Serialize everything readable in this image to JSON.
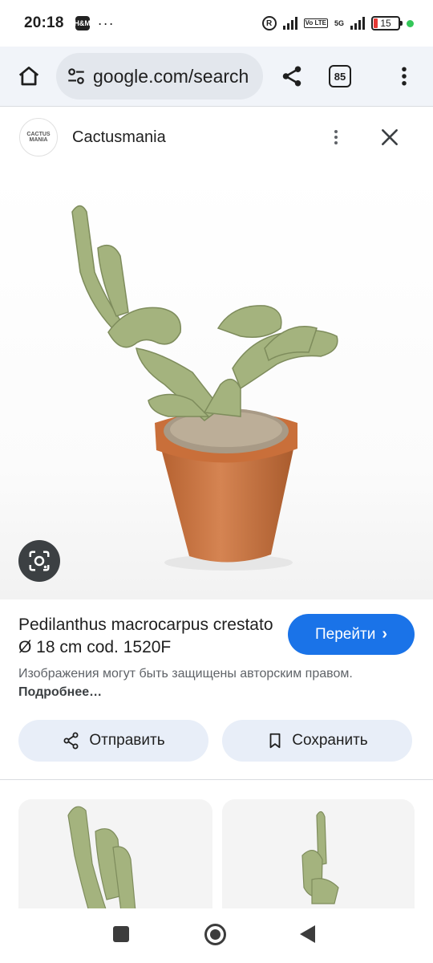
{
  "status_bar": {
    "time": "20:18",
    "notification_badge": "H&M",
    "overflow": "···",
    "battery_level": "15",
    "network": "5G",
    "volte": "Vo LTE",
    "registered_mark": "R"
  },
  "browser": {
    "url": "google.com/search",
    "tab_count": "85",
    "icons": [
      "home-icon",
      "site-settings-icon",
      "share-icon",
      "more-vert-icon"
    ]
  },
  "panel": {
    "site_name": "Cactusmania",
    "favicon_text": "CACTUS MANIA",
    "title": "Pedilanthus macrocarpus crestato Ø 18 cm cod. 1520F",
    "goto_label": "Перейти",
    "goto_chevron": "›",
    "copyright_text": "Изображения могут быть защищены авторским правом.",
    "copyright_link": "Подробнее…",
    "send_label": "Отправить",
    "save_label": "Сохранить"
  },
  "colors": {
    "accent_blue": "#1a73e8",
    "pill_bg": "#e8eef8",
    "toolbar_bg": "#f1f4f9",
    "pot_terracotta": "#c8733f",
    "cactus_green": "#9fb07a"
  }
}
